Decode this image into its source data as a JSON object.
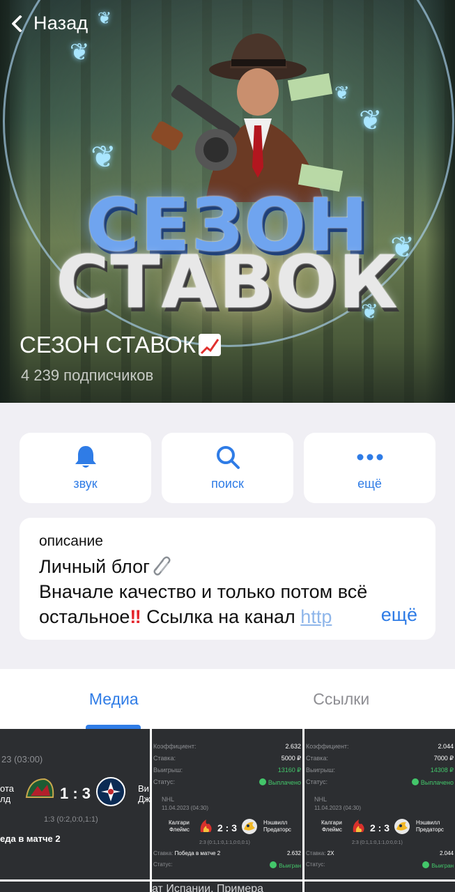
{
  "header": {
    "back_label": "Назад",
    "channel_title": "СЕЗОН СТАВОК",
    "title_emoji": "chart-increasing-icon",
    "subscribers": "4 239 подписчиков",
    "cover_text_line1": "СЕЗОН",
    "cover_text_line2": "СТАВОК"
  },
  "actions": [
    {
      "label": "звук",
      "icon": "bell-icon"
    },
    {
      "label": "поиск",
      "icon": "search-icon"
    },
    {
      "label": "ещё",
      "icon": "more-dots-icon"
    }
  ],
  "description": {
    "caption": "описание",
    "line1": "Личный блог",
    "line2": "Вначале качество и только потом всё",
    "line3_text": "остальное",
    "line3_after": " Ссылка на канал ",
    "link_text": "http",
    "more_label": "ещё"
  },
  "tabs": [
    {
      "label": "Медиа",
      "active": true
    },
    {
      "label": "Ссылки",
      "active": false
    }
  ],
  "media": {
    "tile1": {
      "date": "23 (03:00)",
      "team_left": [
        "ота",
        "лд"
      ],
      "score": "1 : 3",
      "team_right": [
        "Ви",
        "Дж"
      ],
      "detail": "1:3 (0:2,0:0,1:1)",
      "bet": "еда в матче 2"
    },
    "tile2": {
      "rows": [
        {
          "label": "Коэффициент:",
          "value": "2.632"
        },
        {
          "label": "Ставка:",
          "value": "5000 ₽"
        },
        {
          "label": "Выигрыш:",
          "value": "13160 ₽"
        },
        {
          "label": "Статус:",
          "value": "Выплачено"
        }
      ],
      "league": "NHL",
      "date": "11.04.2023 (04:30)",
      "team_left": [
        "Калгари",
        "Флеймс"
      ],
      "score": "2 : 3",
      "team_right": [
        "Нэшвилл",
        "Предаторс"
      ],
      "detail": "2:3 (0:1,1:0,1:1,0:0,0:1)",
      "bet_label": "Ставка:",
      "bet_value": "Победа в матче 2",
      "bet_coef": "2.632",
      "status_label": "Статус:",
      "status_value": "Выигран"
    },
    "tile3": {
      "rows": [
        {
          "label": "Коэффициент:",
          "value": "2.044"
        },
        {
          "label": "Ставка:",
          "value": "7000 ₽"
        },
        {
          "label": "Выигрыш:",
          "value": "14308 ₽"
        },
        {
          "label": "Статус:",
          "value": "Выплачено"
        }
      ],
      "league": "NHL",
      "date": "11.04.2023 (04:30)",
      "team_left": [
        "Калгари",
        "Флеймс"
      ],
      "score": "2 : 3",
      "team_right": [
        "Нэшвилл",
        "Предаторс"
      ],
      "detail": "2:3 (0:1,1:0,1:1,0:0,0:1)",
      "bet_label": "Ставка:",
      "bet_value": "2X",
      "bet_coef": "2.044",
      "status_label": "Статус:",
      "status_value": "Выигран"
    },
    "tile5_text": "ат Испании. Примера"
  },
  "colors": {
    "accent": "#2f7ce6",
    "background": "#f0eff4",
    "status_green": "#43c66a",
    "alert_red": "#e4242b"
  }
}
